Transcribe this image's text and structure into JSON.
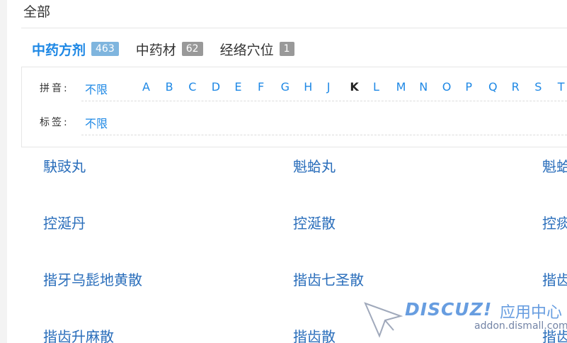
{
  "breadcrumb": {
    "label": "全部"
  },
  "tabs": [
    {
      "label": "中药方剂",
      "count": "463",
      "active": true
    },
    {
      "label": "中药材",
      "count": "62",
      "active": false
    },
    {
      "label": "经络穴位",
      "count": "1",
      "active": false
    }
  ],
  "filters": {
    "pinyin": {
      "label": "拼音:",
      "unlimited": "不限",
      "letters": [
        "A",
        "B",
        "C",
        "D",
        "E",
        "F",
        "G",
        "H",
        "J",
        "K",
        "L",
        "M",
        "N",
        "O",
        "P",
        "Q",
        "R",
        "S",
        "T"
      ],
      "selected": "K"
    },
    "tag": {
      "label": "标签:",
      "unlimited": "不限"
    }
  },
  "items": [
    [
      "駃豉丸",
      "魁蛤丸",
      "魁蛤"
    ],
    [
      "控涎丹",
      "控涎散",
      "控痰"
    ],
    [
      "揩牙乌髭地黄散",
      "揩齿七圣散",
      "揩齿"
    ],
    [
      "揩齿升麻散",
      "揩齿散",
      "揩齿"
    ]
  ],
  "watermark": {
    "brand": "DISCUZ!",
    "suffix": "应用中心",
    "url": "addon.dismall.com"
  },
  "colors": {
    "accent": "#1e88e5",
    "link": "#2a6ebb",
    "badge_active": "#7fb5de",
    "badge_inactive": "#999999"
  }
}
